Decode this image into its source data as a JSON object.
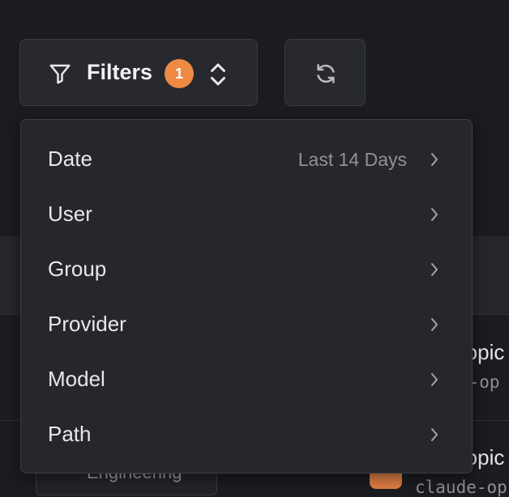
{
  "toolbar": {
    "filters_label": "Filters",
    "filters_count": "1",
    "badge_color": "#ef8a43"
  },
  "menu": {
    "items": [
      {
        "label": "Date",
        "value": "Last 14 Days"
      },
      {
        "label": "User",
        "value": ""
      },
      {
        "label": "Group",
        "value": ""
      },
      {
        "label": "Provider",
        "value": ""
      },
      {
        "label": "Model",
        "value": ""
      },
      {
        "label": "Path",
        "value": ""
      }
    ]
  },
  "background": {
    "row1_title": "ropic",
    "row1_sub": "e-op",
    "row2_title": "ropic",
    "row2_sub": "claude-op",
    "group_chip": "Engineering"
  }
}
